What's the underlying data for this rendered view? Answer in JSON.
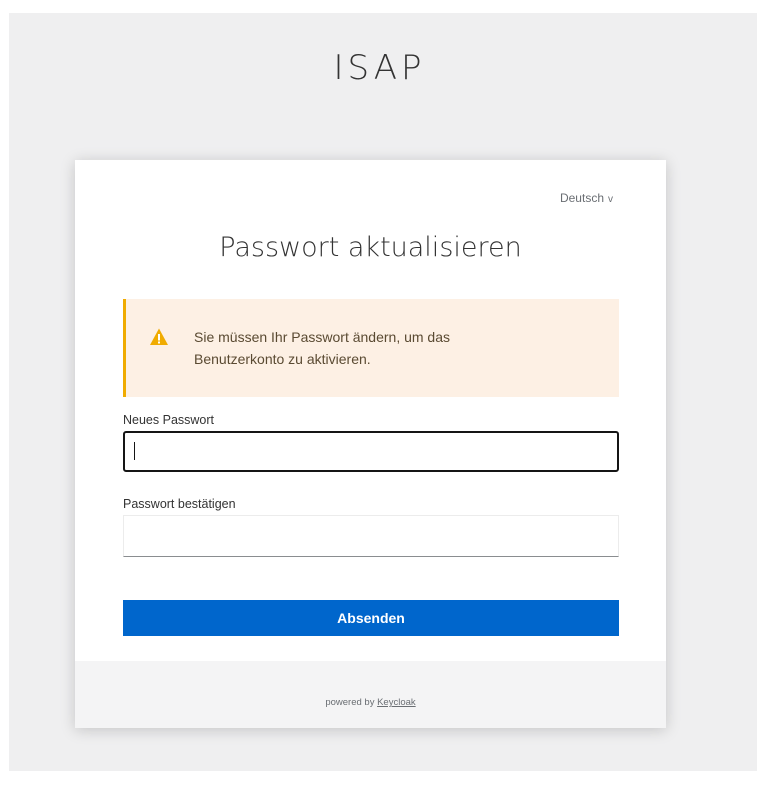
{
  "app": {
    "brand": "ISAP"
  },
  "language": {
    "selected": "Deutsch",
    "chevron": "v"
  },
  "page": {
    "title": "Passwort aktualisieren"
  },
  "alert": {
    "icon": "warning-icon",
    "color": "#f0ab00",
    "message": "Sie müssen Ihr Passwort ändern, um das Benutzerkonto zu aktivieren."
  },
  "form": {
    "new_password": {
      "label": "Neues Passwort",
      "value": ""
    },
    "confirm_password": {
      "label": "Passwort bestätigen",
      "value": ""
    },
    "submit_label": "Absenden",
    "submit_color": "#0066cc"
  },
  "footer": {
    "powered_prefix": "powered by",
    "powered_link": "Keycloak"
  }
}
